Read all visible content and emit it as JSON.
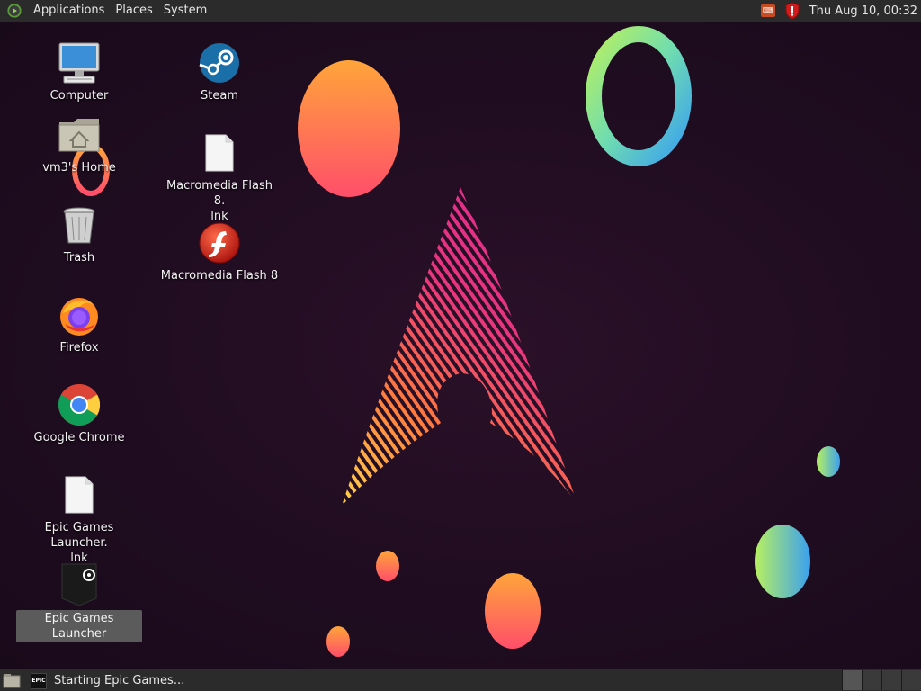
{
  "top_panel": {
    "menus": [
      "Applications",
      "Places",
      "System"
    ],
    "clock": "Thu Aug 10, 00:32"
  },
  "desktop": {
    "icons": [
      {
        "label": "Computer",
        "icon": "computer-icon"
      },
      {
        "label": "vm3's Home",
        "icon": "home-folder-icon"
      },
      {
        "label": "Trash",
        "icon": "trash-icon"
      },
      {
        "label": "Firefox",
        "icon": "firefox-icon"
      },
      {
        "label": "Google Chrome",
        "icon": "chrome-icon"
      },
      {
        "label": "Epic Games Launcher.\nlnk",
        "icon": "file-icon"
      },
      {
        "label": "Epic Games Launcher",
        "icon": "epic-games-icon",
        "selected": true
      },
      {
        "label": "Steam",
        "icon": "steam-icon"
      },
      {
        "label": "Macromedia Flash 8.\nlnk",
        "icon": "file-icon"
      },
      {
        "label": "Macromedia Flash 8",
        "icon": "flash-icon"
      }
    ],
    "epic_logo_text": "EPIC GAMES"
  },
  "taskbar": {
    "task_label": "Starting Epic Games...",
    "task_icon_text": "EPIC"
  },
  "colors": {
    "panel": "#2b2b2b",
    "wallpaper": "#1f0c20",
    "accent_pink": "#e23d7a",
    "accent_orange": "#ff7a3d"
  }
}
